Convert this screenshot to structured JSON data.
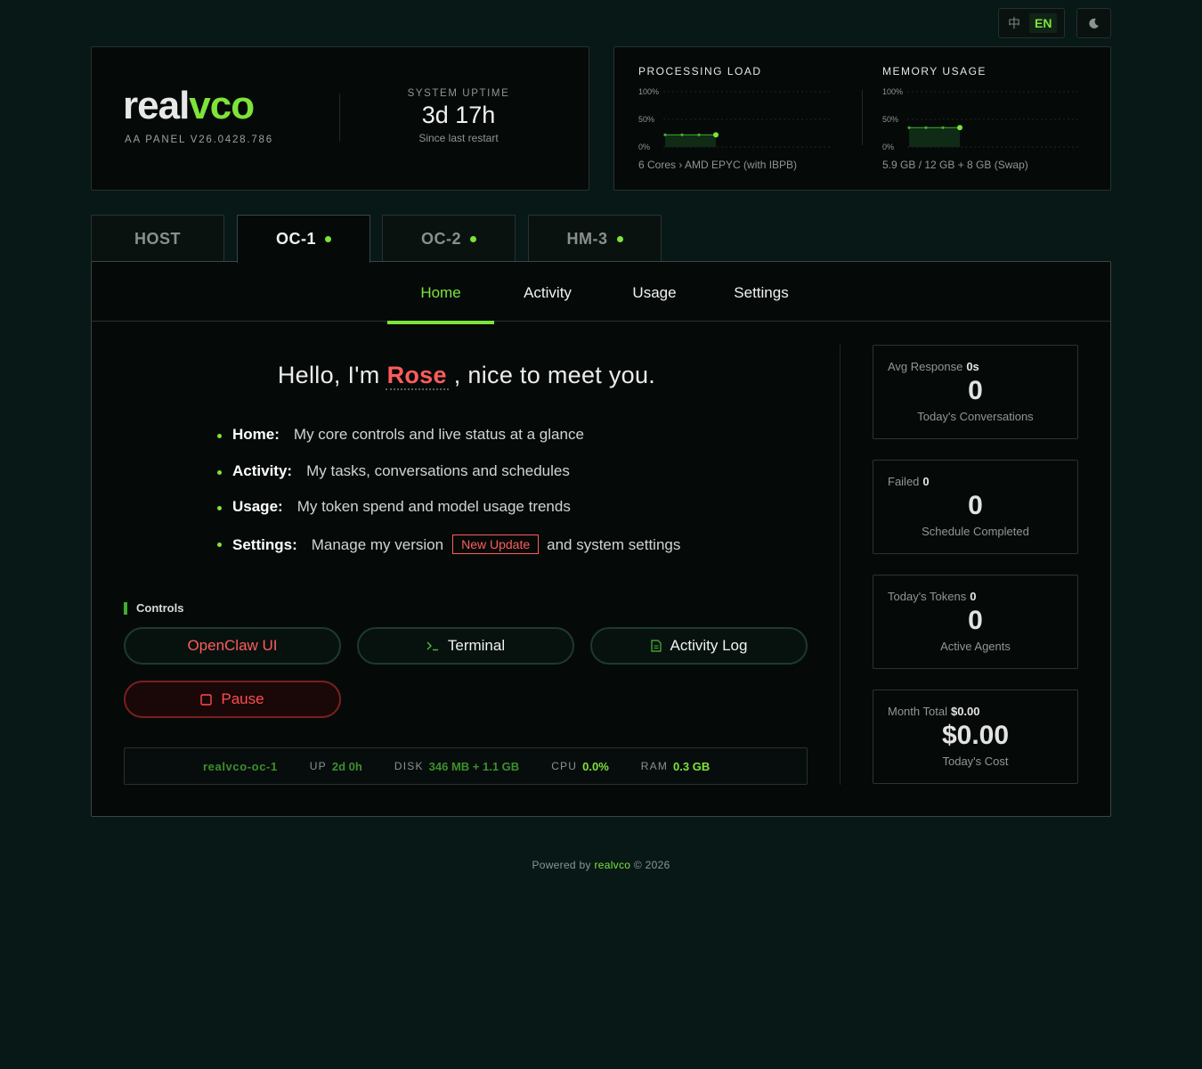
{
  "header": {
    "lang_options": [
      "中",
      "EN"
    ],
    "lang_active": "EN",
    "theme_icon": "moon-icon"
  },
  "brand": {
    "logo_part1": "real",
    "logo_part2": "vco",
    "version": "AA PANEL V26.0428.786",
    "uptime_label": "SYSTEM UPTIME",
    "uptime_value": "3d 17h",
    "uptime_sub": "Since last restart"
  },
  "system_stats": {
    "processing": {
      "title": "PROCESSING LOAD",
      "ticks": [
        "100%",
        "50%",
        "0%"
      ],
      "points": [
        0.22,
        0.22,
        0.22,
        0.22
      ],
      "footer": "6 Cores › AMD EPYC (with IBPB)"
    },
    "memory": {
      "title": "MEMORY USAGE",
      "ticks": [
        "100%",
        "50%",
        "0%"
      ],
      "points": [
        0.35,
        0.35,
        0.35,
        0.35
      ],
      "footer": "5.9 GB / 12 GB + 8 GB (Swap)"
    }
  },
  "host_tabs": [
    {
      "label": "HOST",
      "status": false,
      "active": false
    },
    {
      "label": "OC-1",
      "status": true,
      "active": true
    },
    {
      "label": "OC-2",
      "status": true,
      "active": false
    },
    {
      "label": "HM-3",
      "status": true,
      "active": false
    }
  ],
  "subtabs": [
    {
      "label": "Home",
      "active": true
    },
    {
      "label": "Activity",
      "active": false
    },
    {
      "label": "Usage",
      "active": false
    },
    {
      "label": "Settings",
      "active": false
    }
  ],
  "home": {
    "greeting_pre": "Hello, I'm",
    "agent_name": "Rose",
    "greeting_post": ", nice to meet you.",
    "features": [
      {
        "name": "Home",
        "sep": ":",
        "desc": "My core controls and live status at a glance"
      },
      {
        "name": "Activity",
        "sep": ":",
        "desc": "My tasks, conversations and schedules"
      },
      {
        "name": "Usage",
        "sep": ":",
        "desc": "My token spend and model usage trends"
      },
      {
        "name": "Settings",
        "sep": ":",
        "desc": "Manage my version",
        "badge": "New Update",
        "desc2": "and system settings"
      }
    ],
    "controls_label": "Controls",
    "buttons": {
      "openclaw": "OpenClaw UI",
      "terminal": "Terminal",
      "activity_log": "Activity Log",
      "pause": "Pause"
    },
    "sysbar": {
      "host": "realvco-oc-1",
      "up_label": "UP",
      "up_value": "2d 0h",
      "disk_label": "DISK",
      "disk_value": "346 MB + 1.1 GB",
      "cpu_label": "CPU",
      "cpu_value": "0.0%",
      "ram_label": "RAM",
      "ram_value": "0.3 GB"
    }
  },
  "metrics": [
    {
      "top_label": "Avg Response",
      "top_value": "0s",
      "big": "0",
      "label": "Today's Conversations"
    },
    {
      "top_label": "Failed",
      "top_value": "0",
      "big": "0",
      "label": "Schedule Completed"
    },
    {
      "top_label": "Today's Tokens",
      "top_value": "0",
      "big": "0",
      "label": "Active Agents"
    },
    {
      "top_label": "Month Total",
      "top_value": "$0.00",
      "big": "$0.00",
      "label": "Today's Cost"
    }
  ],
  "footer": {
    "prefix": "Powered by",
    "brand": "realvco",
    "suffix": "© 2026"
  },
  "colors": {
    "accent": "#7ee33a",
    "danger": "#ff5c5c",
    "background": "#071816"
  }
}
